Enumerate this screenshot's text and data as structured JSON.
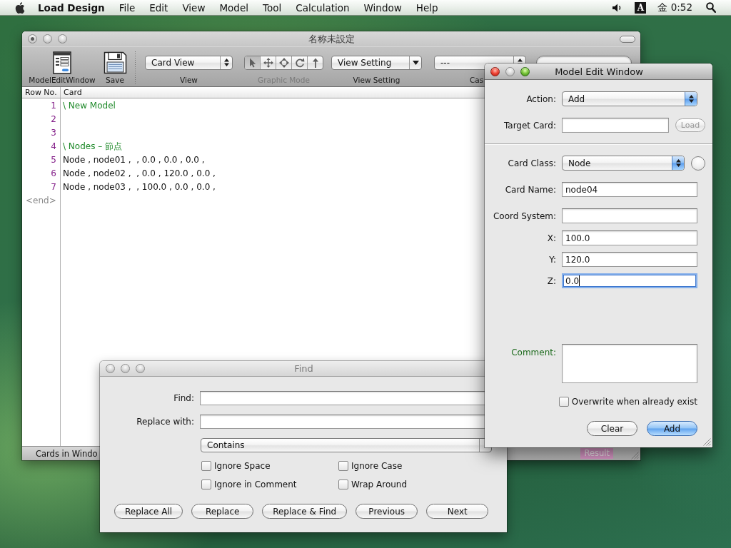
{
  "menu_bar": {
    "app_name": "Load Design",
    "menus": [
      "File",
      "Edit",
      "View",
      "Model",
      "Tool",
      "Calculation",
      "Window",
      "Help"
    ],
    "input_source": "A",
    "clock": "金 0:52"
  },
  "main_window": {
    "title": "名称未設定",
    "active": false,
    "document_edited": true,
    "toolbar": {
      "buttons": [
        {
          "label": "ModelEditWindow",
          "kind": "form"
        },
        {
          "label": "Save",
          "kind": "save"
        }
      ],
      "view": {
        "value": "Card View",
        "label": "View"
      },
      "graphic_mode": {
        "label": "Graphic Mode",
        "disabled": true,
        "segments": [
          {
            "kind": "pointer",
            "selected": true
          },
          {
            "kind": "move",
            "selected": false
          },
          {
            "kind": "circle",
            "selected": false
          },
          {
            "kind": "rotate",
            "selected": false
          },
          {
            "kind": "up",
            "selected": false
          }
        ]
      },
      "view_setting": {
        "value": "View Setting",
        "label": "View Setting"
      },
      "case": {
        "value": "---",
        "label": "Cas"
      }
    },
    "table": {
      "columns": [
        "Row No.",
        "Card"
      ],
      "rows": [
        {
          "number": "1",
          "kind": "comment",
          "text": "\\ New Model"
        },
        {
          "number": "2",
          "kind": "blank"
        },
        {
          "number": "3",
          "kind": "blank"
        },
        {
          "number": "4",
          "kind": "comment",
          "text": "\\ Nodes – 節点"
        },
        {
          "number": "5",
          "kind": "card",
          "text": "Node , node01 ,  , 0.0 , 0.0 , 0.0 ,"
        },
        {
          "number": "6",
          "kind": "card",
          "text": "Node , node02 ,  , 0.0 , 120.0 , 0.0 ,"
        },
        {
          "number": "7",
          "kind": "card",
          "text": "Node , node03 ,  , 100.0 , 0.0 , 0.0 ,"
        }
      ],
      "end_marker": "<end>"
    },
    "status_bar": {
      "text": "Cards in Windo",
      "result": "Result"
    }
  },
  "model_edit_window": {
    "title": "Model Edit Window",
    "active": true,
    "minimize_enabled": false,
    "action": {
      "label": "Action:",
      "value": "Add"
    },
    "target_card": {
      "label": "Target Card:"
    },
    "load_button": {
      "label": "Load",
      "disabled": true
    },
    "card_class": {
      "label": "Card Class:",
      "value": "Node"
    },
    "fields": [
      {
        "label": "Card Name:",
        "value": "node04",
        "focused": false
      },
      {
        "label": "Coord System:",
        "focused": false
      },
      {
        "label": "X:",
        "value": "100.0",
        "focused": false
      },
      {
        "label": "Y:",
        "value": "120.0",
        "focused": false
      },
      {
        "label": "Z:",
        "value": "0.0",
        "focused": true
      }
    ],
    "comment": {
      "label": "Comment:"
    },
    "overwrite": {
      "label": "Overwrite when already exist",
      "checked": false
    },
    "buttons": [
      {
        "label": "Clear",
        "default": false
      },
      {
        "label": "Add",
        "default": true
      }
    ]
  },
  "find_window": {
    "title": "Find",
    "active": false,
    "fields": [
      {
        "label": "Find:"
      },
      {
        "label": "Replace with:"
      }
    ],
    "match": {
      "value": "Contains"
    },
    "options": [
      {
        "label": "Ignore Space",
        "checked": false
      },
      {
        "label": "Ignore Case",
        "checked": false
      },
      {
        "label": "Ignore in Comment",
        "checked": false
      },
      {
        "label": "Wrap Around",
        "checked": false
      }
    ],
    "buttons": [
      "Replace All",
      "Replace",
      "Replace & Find",
      "Previous",
      "Next"
    ]
  }
}
